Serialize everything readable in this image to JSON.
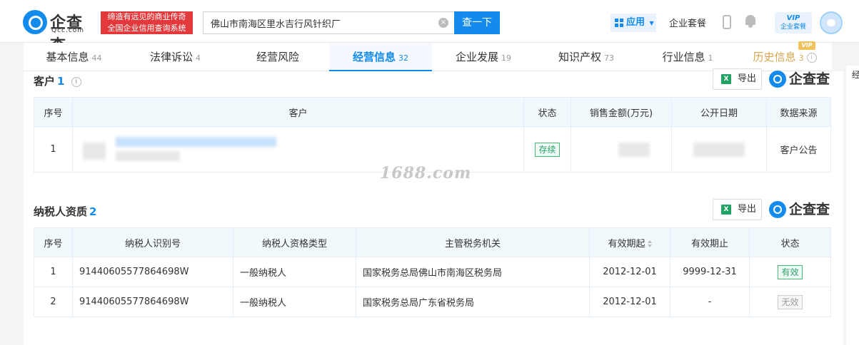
{
  "header": {
    "logo_cn": "企查查",
    "logo_en": "Qcc.com",
    "slogan_line1": "缔造有远见的商业传奇",
    "slogan_line2": "全国企业信用查询系统",
    "search_value": "佛山市南海区里水吉行风针织厂",
    "search_button": "查一下",
    "app_button": "应用",
    "suite_link": "企业套餐",
    "vip_badge_top": "VIP",
    "vip_badge_bottom": "企业套餐"
  },
  "tabs": [
    {
      "label": "基本信息",
      "count": "44"
    },
    {
      "label": "法律诉讼",
      "count": "4"
    },
    {
      "label": "经营风险",
      "count": ""
    },
    {
      "label": "经营信息",
      "count": "32"
    },
    {
      "label": "企业发展",
      "count": "19"
    },
    {
      "label": "知识产权",
      "count": "73"
    },
    {
      "label": "行业信息",
      "count": "1"
    },
    {
      "label": "历史信息",
      "count": "3"
    }
  ],
  "active_tab": "经营信息",
  "history_vip_tag": "VIP",
  "customers": {
    "title": "客户",
    "count": "1",
    "export_label": "导出",
    "brand": "企查查",
    "columns": [
      "序号",
      "客户",
      "状态",
      "销售金额(万元)",
      "公开日期",
      "数据来源"
    ],
    "rows": [
      {
        "index": "1",
        "status": "存续",
        "source": "客户公告"
      }
    ]
  },
  "watermark": "1688.com",
  "taxpayer": {
    "title": "纳税人资质",
    "count": "2",
    "export_label": "导出",
    "brand": "企查查",
    "columns": [
      "序号",
      "纳税人识别号",
      "纳税人资格类型",
      "主管税务机关",
      "有效期起",
      "有效期止",
      "状态"
    ],
    "rows": [
      {
        "index": "1",
        "tax_id": "91440605577864698W",
        "type": "一般纳税人",
        "authority": "国家税务总局佛山市南海区税务局",
        "valid_from": "2012-12-01",
        "valid_to": "9999-12-31",
        "status": "有效"
      },
      {
        "index": "2",
        "tax_id": "91440605577864698W",
        "type": "一般纳税人",
        "authority": "国家税务总局广东省税务局",
        "valid_from": "2012-12-01",
        "valid_to": "-",
        "status": "无效"
      }
    ]
  },
  "right_strip_chars": [
    "经"
  ],
  "colors": {
    "brand_blue": "#128bed",
    "slogan_red": "#e4393c",
    "vip_gold": "#d9a64e",
    "status_green": "#2aa16b"
  }
}
